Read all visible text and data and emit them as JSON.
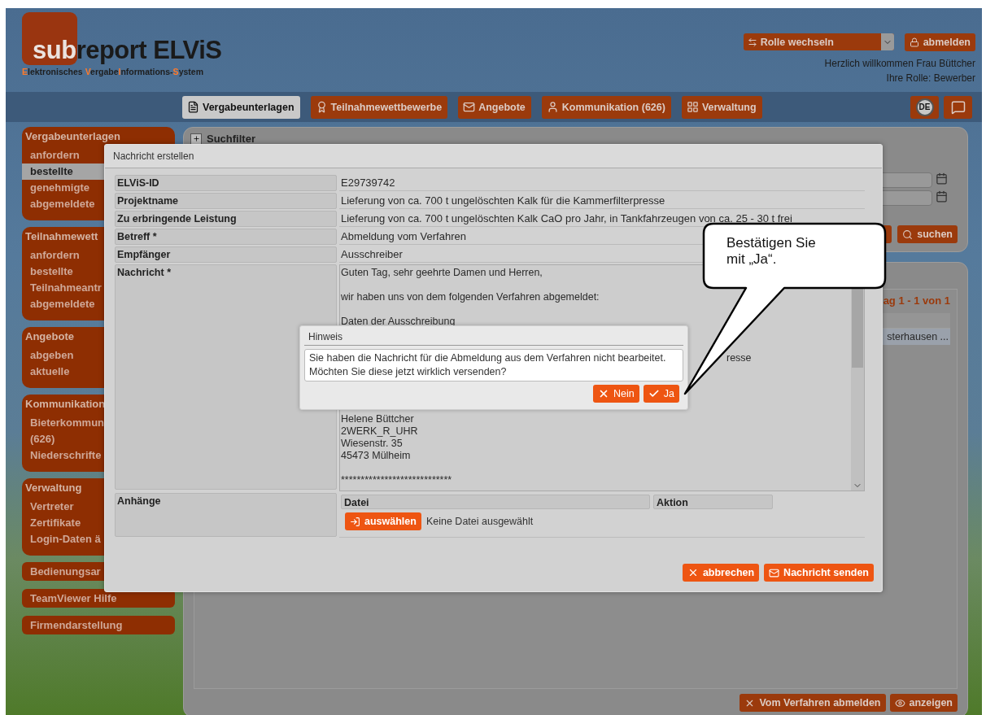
{
  "header": {
    "logo": [
      {
        "kind": "badge",
        "text": "sub"
      },
      {
        "kind": "plain",
        "text": "report ELViS"
      }
    ],
    "tagline": [
      {
        "text": "E",
        "accent": true
      },
      {
        "text": "lektronisches ",
        "accent": false
      },
      {
        "text": "V",
        "accent": true
      },
      {
        "text": "ergabe",
        "accent": false
      },
      {
        "text": "I",
        "accent": true
      },
      {
        "text": "nformations-",
        "accent": false
      },
      {
        "text": "S",
        "accent": true
      },
      {
        "text": "ystem",
        "accent": false
      }
    ],
    "role_select": {
      "value": "Rolle wechseln"
    },
    "logout": "abmelden",
    "welcome": "Herzlich willkommen Frau Büttcher",
    "role": "Ihre Rolle: Bewerber"
  },
  "nav": {
    "tabs": [
      {
        "label": "Vergabeunterlagen",
        "selected": true
      },
      {
        "label": "Teilnahmewettbewerbe",
        "selected": false
      },
      {
        "label": "Angebote",
        "selected": false
      },
      {
        "label": "Kommunikation (626)",
        "selected": false
      },
      {
        "label": "Verwaltung",
        "selected": false
      }
    ],
    "language": "DE"
  },
  "sidebar": [
    {
      "kind": "group",
      "title": "Vergabeunterlagen",
      "items": [
        {
          "label": "anfordern",
          "selected": false
        },
        {
          "label": "bestellte",
          "selected": true
        },
        {
          "label": "genehmigte",
          "selected": false
        },
        {
          "label": "abgemeldete",
          "selected": false
        }
      ]
    },
    {
      "kind": "group",
      "title": "Teilnahmewett",
      "items": [
        {
          "label": "anfordern",
          "selected": false
        },
        {
          "label": "bestellte",
          "selected": false
        },
        {
          "label": "Teilnahmeantr",
          "selected": false
        },
        {
          "label": "abgemeldete",
          "selected": false
        }
      ]
    },
    {
      "kind": "group",
      "title": "Angebote",
      "items": [
        {
          "label": "abgeben",
          "selected": false
        },
        {
          "label": "aktuelle",
          "selected": false
        }
      ]
    },
    {
      "kind": "group",
      "title": "Kommunikation",
      "items": [
        {
          "label": "Bieterkommun\n(626)",
          "selected": false
        },
        {
          "label": "Niederschrifte",
          "selected": false
        }
      ]
    },
    {
      "kind": "group",
      "title": "Verwaltung",
      "items": [
        {
          "label": "Vertreter",
          "selected": false
        },
        {
          "label": "Zertifikate",
          "selected": false
        },
        {
          "label": "Login-Daten ä",
          "selected": false
        }
      ]
    },
    {
      "kind": "link",
      "label": "Bedienungsar"
    },
    {
      "kind": "link",
      "label": "TeamViewer Hilfe"
    },
    {
      "kind": "link",
      "label": "Firmendarstellung"
    }
  ],
  "content": {
    "search_filter": {
      "title": "Suchfilter",
      "search_button": "suchen"
    },
    "results": {
      "pager": "ag 1 - 1 von 1",
      "cell": "sterhausen ...",
      "buttons": [
        {
          "kind": "unsubscribe",
          "label": "Vom Verfahren abmelden"
        },
        {
          "kind": "show",
          "label": "anzeigen"
        }
      ]
    }
  },
  "dialog": {
    "title": "Nachricht erstellen",
    "fields": [
      {
        "label": "ELViS-ID",
        "value": "E29739742"
      },
      {
        "label": "Projektname",
        "value": "Lieferung von ca. 700 t ungelöschten Kalk für die Kammerfilterpresse"
      },
      {
        "label": "Zu erbringende Leistung",
        "value": "Lieferung von ca. 700 t ungelöschten Kalk CaO pro Jahr, in Tankfahrzeugen von ca. 25 - 30 t frei"
      },
      {
        "label": "Betreff *",
        "value": "Abmeldung vom Verfahren"
      },
      {
        "label": "Empfänger",
        "value": "Ausschreiber"
      }
    ],
    "message": {
      "label": "Nachricht *",
      "lines": [
        {
          "kind": "line",
          "text": "Guten Tag, sehr geehrte Damen und Herren,"
        },
        {
          "kind": "blank"
        },
        {
          "kind": "line",
          "text": "wir haben uns von dem folgenden Verfahren abgemeldet:"
        },
        {
          "kind": "blank"
        },
        {
          "kind": "line",
          "text": "Daten der Ausschreibung"
        },
        {
          "kind": "blank"
        },
        {
          "kind": "blank"
        },
        {
          "kind": "tail",
          "text": "resse"
        },
        {
          "kind": "blank"
        },
        {
          "kind": "blank"
        },
        {
          "kind": "blank"
        },
        {
          "kind": "blank"
        },
        {
          "kind": "line",
          "text": "Helene Büttcher"
        },
        {
          "kind": "line",
          "text": "2WERK_R_UHR"
        },
        {
          "kind": "line",
          "text": "Wiesenstr. 35"
        },
        {
          "kind": "line",
          "text": "45473 Mülheim"
        },
        {
          "kind": "blank"
        },
        {
          "kind": "line",
          "text": "****************************"
        }
      ]
    },
    "attachments": {
      "label": "Anhänge",
      "columns": [
        "Datei",
        "Aktion"
      ],
      "choose_button": "auswählen",
      "file_status": "Keine Datei ausgewählt"
    },
    "buttons": [
      {
        "kind": "cancel",
        "label": "abbrechen"
      },
      {
        "kind": "send",
        "label": "Nachricht senden"
      }
    ]
  },
  "hint": {
    "title": "Hinweis",
    "message": "Sie haben die Nachricht für die Abmeldung aus dem Verfahren nicht bearbeitet. Möchten Sie diese jetzt wirklich versenden?",
    "buttons": [
      {
        "kind": "no",
        "label": "Nein"
      },
      {
        "kind": "yes",
        "label": "Ja"
      }
    ]
  },
  "callout": {
    "text": "Bestätigen Sie mit „Ja“."
  }
}
